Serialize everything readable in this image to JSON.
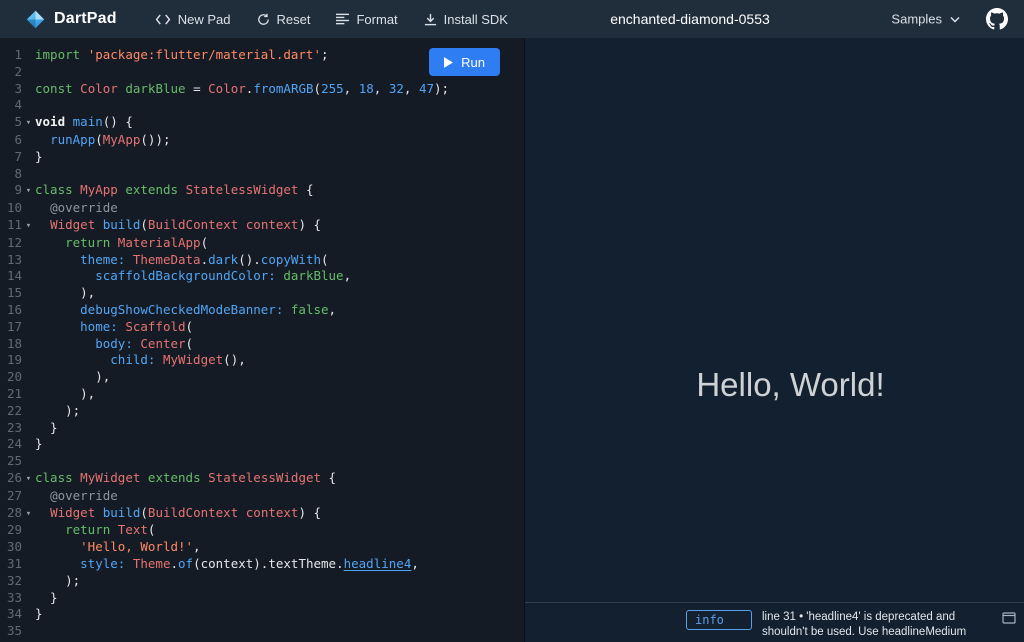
{
  "header": {
    "logo": {
      "label": "DartPad"
    },
    "nav": [
      {
        "id": "new-pad",
        "label": "New Pad"
      },
      {
        "id": "reset",
        "label": "Reset"
      },
      {
        "id": "format",
        "label": "Format"
      },
      {
        "id": "install-sdk",
        "label": "Install SDK"
      }
    ],
    "title": "enchanted-diamond-0553",
    "samples": {
      "label": "Samples"
    }
  },
  "icons": {
    "logo": "dart-diamond",
    "new_pad": "code-brackets",
    "reset": "refresh-arrow",
    "format": "align-lines",
    "install_sdk": "download-arrow",
    "samples": "chevron-down",
    "github": "octocat",
    "run": "play-triangle",
    "fold": "▾",
    "console_window": "window-outline"
  },
  "colors": {
    "accent": "#2e7df2",
    "output_bg": "#12202f",
    "info_color": "#5b9fe8"
  },
  "editor": {
    "run_button": "Run",
    "lines": [
      {
        "n": 1,
        "fold": false,
        "tok": [
          [
            "import",
            "k"
          ],
          [
            " "
          ],
          [
            "'package:flutter/material.dart'",
            "s"
          ],
          [
            ";"
          ]
        ]
      },
      {
        "n": 2,
        "fold": false,
        "tok": []
      },
      {
        "n": 3,
        "fold": false,
        "tok": [
          [
            "const",
            "k"
          ],
          [
            " "
          ],
          [
            "Color",
            "t"
          ],
          [
            " "
          ],
          [
            "darkBlue",
            "k"
          ],
          [
            " = "
          ],
          [
            "Color",
            "t"
          ],
          [
            "."
          ],
          [
            "fromARGB",
            "f"
          ],
          [
            "("
          ],
          [
            "255",
            "n"
          ],
          [
            ", "
          ],
          [
            "18",
            "n"
          ],
          [
            ", "
          ],
          [
            "32",
            "n"
          ],
          [
            ", "
          ],
          [
            "47",
            "n"
          ],
          [
            ");"
          ]
        ]
      },
      {
        "n": 4,
        "fold": false,
        "tok": []
      },
      {
        "n": 5,
        "fold": true,
        "tok": [
          [
            "void",
            "b"
          ],
          [
            " "
          ],
          [
            "main",
            "f"
          ],
          [
            "() {"
          ]
        ]
      },
      {
        "n": 6,
        "fold": false,
        "tok": [
          [
            "  "
          ],
          [
            "runApp",
            "f"
          ],
          [
            "("
          ],
          [
            "MyApp",
            "t"
          ],
          [
            "());"
          ]
        ]
      },
      {
        "n": 7,
        "fold": false,
        "tok": [
          [
            "}"
          ]
        ]
      },
      {
        "n": 8,
        "fold": false,
        "tok": []
      },
      {
        "n": 9,
        "fold": true,
        "tok": [
          [
            "class",
            "k"
          ],
          [
            " "
          ],
          [
            "MyApp",
            "t"
          ],
          [
            " "
          ],
          [
            "extends",
            "k"
          ],
          [
            " "
          ],
          [
            "StatelessWidget",
            "t"
          ],
          [
            " {"
          ]
        ]
      },
      {
        "n": 10,
        "fold": false,
        "tok": [
          [
            "  "
          ],
          [
            "@override",
            "a"
          ]
        ]
      },
      {
        "n": 11,
        "fold": true,
        "tok": [
          [
            "  "
          ],
          [
            "Widget",
            "t"
          ],
          [
            " "
          ],
          [
            "build",
            "f"
          ],
          [
            "("
          ],
          [
            "BuildContext",
            "t"
          ],
          [
            " "
          ],
          [
            "context",
            "t"
          ],
          [
            ") {"
          ]
        ]
      },
      {
        "n": 12,
        "fold": false,
        "tok": [
          [
            "    "
          ],
          [
            "return",
            "k"
          ],
          [
            " "
          ],
          [
            "MaterialApp",
            "t"
          ],
          [
            "("
          ]
        ]
      },
      {
        "n": 13,
        "fold": false,
        "tok": [
          [
            "      "
          ],
          [
            "theme:",
            "f"
          ],
          [
            " "
          ],
          [
            "ThemeData",
            "t"
          ],
          [
            "."
          ],
          [
            "dark",
            "f"
          ],
          [
            "()."
          ],
          [
            "copyWith",
            "f"
          ],
          [
            "("
          ]
        ]
      },
      {
        "n": 14,
        "fold": false,
        "tok": [
          [
            "        "
          ],
          [
            "scaffoldBackgroundColor:",
            "f"
          ],
          [
            " "
          ],
          [
            "darkBlue",
            "k"
          ],
          [
            ","
          ]
        ]
      },
      {
        "n": 15,
        "fold": false,
        "tok": [
          [
            "      ),"
          ]
        ]
      },
      {
        "n": 16,
        "fold": false,
        "tok": [
          [
            "      "
          ],
          [
            "debugShowCheckedModeBanner:",
            "f"
          ],
          [
            " "
          ],
          [
            "false",
            "k"
          ],
          [
            ","
          ]
        ]
      },
      {
        "n": 17,
        "fold": false,
        "tok": [
          [
            "      "
          ],
          [
            "home:",
            "f"
          ],
          [
            " "
          ],
          [
            "Scaffold",
            "t"
          ],
          [
            "("
          ]
        ]
      },
      {
        "n": 18,
        "fold": false,
        "tok": [
          [
            "        "
          ],
          [
            "body:",
            "f"
          ],
          [
            " "
          ],
          [
            "Center",
            "t"
          ],
          [
            "("
          ]
        ]
      },
      {
        "n": 19,
        "fold": false,
        "tok": [
          [
            "          "
          ],
          [
            "child:",
            "f"
          ],
          [
            " "
          ],
          [
            "MyWidget",
            "t"
          ],
          [
            "(),"
          ]
        ]
      },
      {
        "n": 20,
        "fold": false,
        "tok": [
          [
            "        ),"
          ]
        ]
      },
      {
        "n": 21,
        "fold": false,
        "tok": [
          [
            "      ),"
          ]
        ]
      },
      {
        "n": 22,
        "fold": false,
        "tok": [
          [
            "    );"
          ]
        ]
      },
      {
        "n": 23,
        "fold": false,
        "tok": [
          [
            "  }"
          ]
        ]
      },
      {
        "n": 24,
        "fold": false,
        "tok": [
          [
            "}"
          ]
        ]
      },
      {
        "n": 25,
        "fold": false,
        "tok": []
      },
      {
        "n": 26,
        "fold": true,
        "tok": [
          [
            "class",
            "k"
          ],
          [
            " "
          ],
          [
            "MyWidget",
            "t"
          ],
          [
            " "
          ],
          [
            "extends",
            "k"
          ],
          [
            " "
          ],
          [
            "StatelessWidget",
            "t"
          ],
          [
            " {"
          ]
        ]
      },
      {
        "n": 27,
        "fold": false,
        "tok": [
          [
            "  "
          ],
          [
            "@override",
            "a"
          ]
        ]
      },
      {
        "n": 28,
        "fold": true,
        "tok": [
          [
            "  "
          ],
          [
            "Widget",
            "t"
          ],
          [
            " "
          ],
          [
            "build",
            "f"
          ],
          [
            "("
          ],
          [
            "BuildContext",
            "t"
          ],
          [
            " "
          ],
          [
            "context",
            "t"
          ],
          [
            ") {"
          ]
        ]
      },
      {
        "n": 29,
        "fold": false,
        "tok": [
          [
            "    "
          ],
          [
            "return",
            "k"
          ],
          [
            " "
          ],
          [
            "Text",
            "t"
          ],
          [
            "("
          ]
        ]
      },
      {
        "n": 30,
        "fold": false,
        "tok": [
          [
            "      "
          ],
          [
            "'Hello, World!'",
            "s"
          ],
          [
            ","
          ]
        ]
      },
      {
        "n": 31,
        "fold": false,
        "tok": [
          [
            "      "
          ],
          [
            "style:",
            "f"
          ],
          [
            " "
          ],
          [
            "Theme",
            "t"
          ],
          [
            "."
          ],
          [
            "of",
            "f"
          ],
          [
            "(context)."
          ],
          [
            "textTheme."
          ],
          [
            "headline4",
            "d"
          ],
          [
            ","
          ]
        ]
      },
      {
        "n": 32,
        "fold": false,
        "tok": [
          [
            "    );"
          ]
        ]
      },
      {
        "n": 33,
        "fold": false,
        "tok": [
          [
            "  }"
          ]
        ]
      },
      {
        "n": 34,
        "fold": false,
        "tok": [
          [
            "}"
          ]
        ]
      },
      {
        "n": 35,
        "fold": false,
        "tok": []
      }
    ]
  },
  "output": {
    "hello": "Hello, World!",
    "console": {
      "badge": "info",
      "message": "line 31 • 'headline4' is deprecated and shouldn't be used. Use headlineMedium"
    }
  }
}
